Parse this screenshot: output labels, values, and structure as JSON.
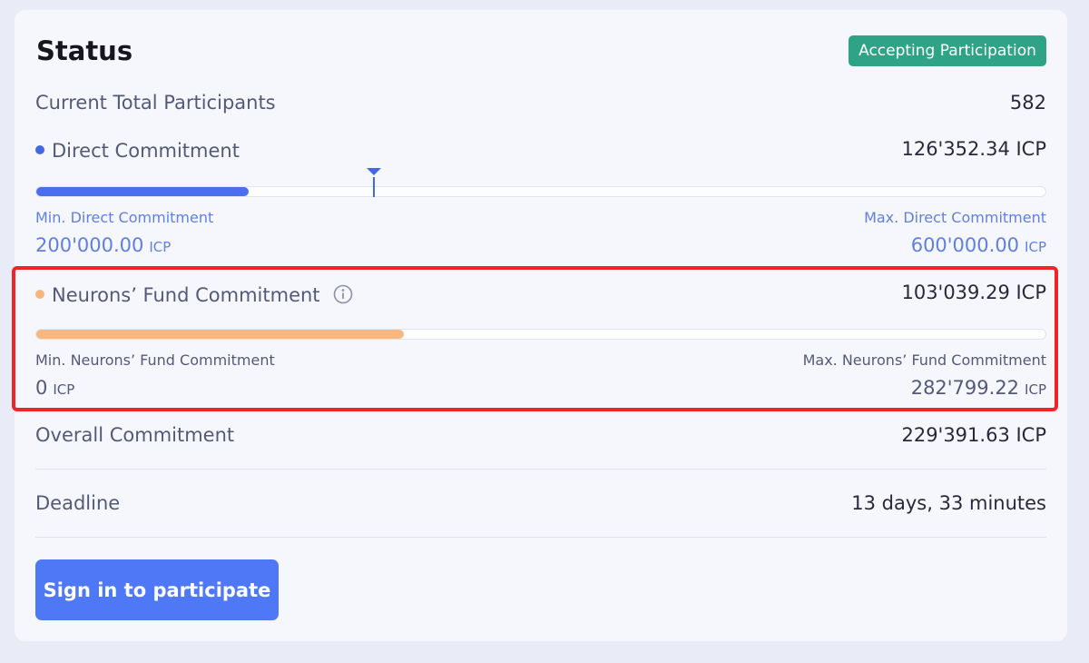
{
  "status": {
    "title": "Status",
    "badge": "Accepting Participation"
  },
  "participants": {
    "label": "Current Total Participants",
    "value": "582"
  },
  "direct": {
    "label": "Direct Commitment",
    "value": "126'352.34 ICP",
    "progress_fraction": 0.21,
    "marker_fraction": 0.335,
    "min_label": "Min. Direct Commitment",
    "min_value": "200'000.00",
    "min_unit": "ICP",
    "max_label": "Max. Direct Commitment",
    "max_value": "600'000.00",
    "max_unit": "ICP",
    "color": "#4b6ef0"
  },
  "neurons_fund": {
    "label": "Neurons’ Fund Commitment",
    "value": "103'039.29 ICP",
    "progress_fraction": 0.364,
    "min_label": "Min. Neurons’ Fund Commitment",
    "min_value": "0",
    "min_unit": "ICP",
    "max_label": "Max. Neurons’ Fund Commitment",
    "max_value": "282'799.22",
    "max_unit": "ICP",
    "color": "#f7b77f"
  },
  "overall": {
    "label": "Overall Commitment",
    "value": "229'391.63 ICP"
  },
  "deadline": {
    "label": "Deadline",
    "value": "13 days, 33 minutes"
  },
  "cta": {
    "label": "Sign in to participate"
  },
  "icons": {
    "info": "info-circle-icon",
    "marker": "triangle-marker-icon"
  },
  "colors": {
    "badge": "#2fa386",
    "button": "#4f78f6",
    "highlight": "#ef2525"
  }
}
